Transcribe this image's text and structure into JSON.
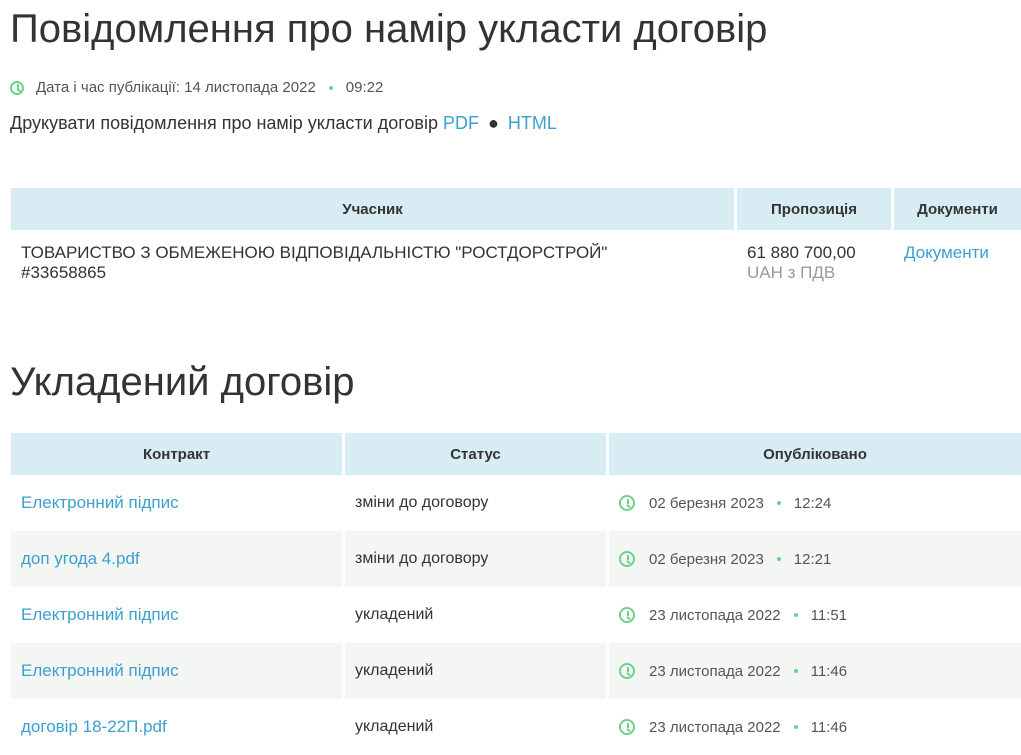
{
  "header": {
    "title": "Повідомлення про намір укласти договір",
    "published_label": "Дата і час публікації: 14 листопада 2022",
    "published_time": "09:22",
    "print_text": "Друкувати повідомлення про намір укласти договір",
    "print_pdf": "PDF",
    "print_sep": "●",
    "print_html": "HTML"
  },
  "offers": {
    "headers": [
      "Учасник",
      "Пропозиція",
      "Документи"
    ],
    "rows": [
      {
        "participant": "ТОВАРИСТВО З ОБМЕЖЕНОЮ ВІДПОВІДАЛЬНІСТЮ \"РОСТДОРСТРОЙ\"",
        "participant_id": "#33658865",
        "amount": "61 880 700,00",
        "currency": "UAH з ПДВ",
        "documents_link": "Документи"
      }
    ]
  },
  "contract": {
    "title": "Укладений договір",
    "headers": [
      "Контракт",
      "Статус",
      "Опубліковано"
    ],
    "rows": [
      {
        "name": "Електронний підпис",
        "status": "зміни до договору",
        "date": "02 березня 2023",
        "time": "12:24"
      },
      {
        "name": "доп угода 4.pdf",
        "status": "зміни до договору",
        "date": "02 березня 2023",
        "time": "12:21"
      },
      {
        "name": "Електронний підпис",
        "status": "укладений",
        "date": "23 листопада 2022",
        "time": "11:51"
      },
      {
        "name": "Електронний підпис",
        "status": "укладений",
        "date": "23 листопада 2022",
        "time": "11:46"
      },
      {
        "name": "договір 18-22П.pdf",
        "status": "укладений",
        "date": "23 листопада 2022",
        "time": "11:46"
      }
    ]
  },
  "colors": {
    "link": "#3d9fd0",
    "header_bg": "#d8ecf3",
    "clock_green": "#6fd18b"
  }
}
